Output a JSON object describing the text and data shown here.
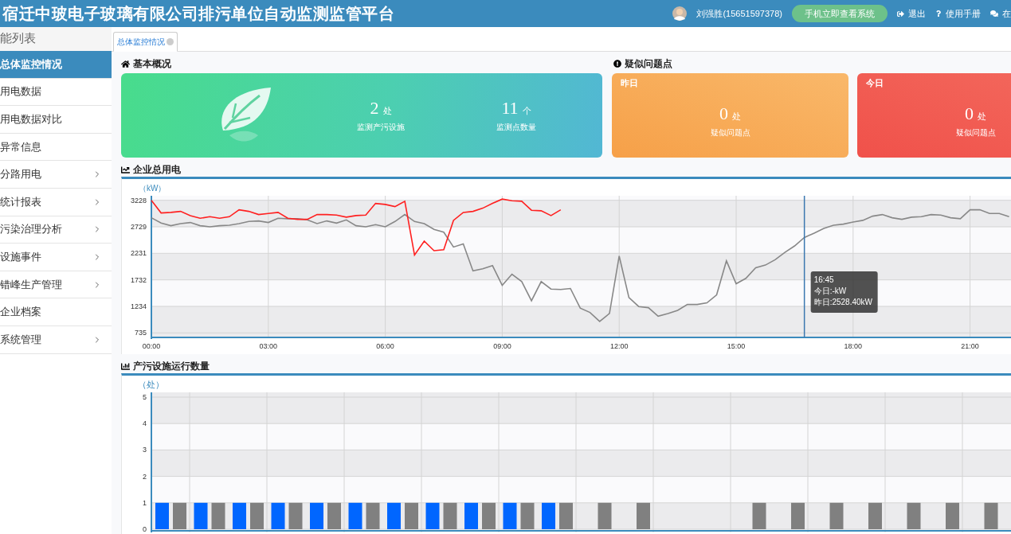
{
  "header": {
    "title": "宿迁中玻电子玻璃有限公司排污单位自动监测监管平台",
    "user": "刘强胜(15651597378)",
    "mobile_button": "手机立即查看系统",
    "links": [
      {
        "kind": "logout",
        "label": "退出"
      },
      {
        "kind": "help",
        "label": "使用手册"
      },
      {
        "kind": "chat",
        "label": "在"
      }
    ]
  },
  "sidebar": {
    "title": "能列表",
    "items": [
      {
        "label": "总体监控情况",
        "selected": true,
        "expandable": false
      },
      {
        "label": "用电数据",
        "selected": false,
        "expandable": false
      },
      {
        "label": "用电数据对比",
        "selected": false,
        "expandable": false
      },
      {
        "label": "异常信息",
        "selected": false,
        "expandable": false
      },
      {
        "label": "分路用电",
        "selected": false,
        "expandable": true
      },
      {
        "label": "统计报表",
        "selected": false,
        "expandable": true
      },
      {
        "label": "污染治理分析",
        "selected": false,
        "expandable": true
      },
      {
        "label": "设施事件",
        "selected": false,
        "expandable": true
      },
      {
        "label": "错峰生产管理",
        "selected": false,
        "expandable": true
      },
      {
        "label": "企业档案",
        "selected": false,
        "expandable": false
      },
      {
        "label": "系统管理",
        "selected": false,
        "expandable": true
      }
    ]
  },
  "tabs": [
    {
      "label": "总体监控情况",
      "selected": true
    }
  ],
  "overview": {
    "title": "基本概况",
    "stats": [
      {
        "value": "2",
        "unit": "处",
        "label": "监测产污设施"
      },
      {
        "value": "11",
        "unit": "个",
        "label": "监测点数量"
      }
    ]
  },
  "issues": {
    "title": "疑似问题点",
    "cards": [
      {
        "kind": "yesterday",
        "title": "昨日",
        "value": "0",
        "unit": "处",
        "label": "疑似问题点"
      },
      {
        "kind": "today",
        "title": "今日",
        "value": "0",
        "unit": "处",
        "label": "疑似问题点"
      }
    ]
  },
  "power_chart": {
    "title": "企业总用电",
    "unit": "（kW）",
    "chart_data": {
      "type": "line",
      "xlim": [
        0,
        22.05
      ],
      "ylim": [
        650,
        3313
      ],
      "xticks": [
        {
          "value": 0,
          "label": "00:00"
        },
        {
          "value": 3,
          "label": "03:00"
        },
        {
          "value": 6,
          "label": "06:00"
        },
        {
          "value": 9,
          "label": "09:00"
        },
        {
          "value": 12,
          "label": "12:00"
        },
        {
          "value": 15,
          "label": "15:00"
        },
        {
          "value": 18,
          "label": "18:00"
        },
        {
          "value": 21,
          "label": "21:00"
        }
      ],
      "yticks": [
        735,
        1234,
        1732,
        2231,
        2729,
        3228
      ],
      "series": [
        {
          "color": "#888888",
          "x": [
            0,
            0.25,
            0.5,
            0.75,
            1,
            1.25,
            1.5,
            1.75,
            2,
            2.25,
            2.5,
            2.75,
            3,
            3.25,
            3.5,
            3.75,
            4,
            4.25,
            4.5,
            4.75,
            5,
            5.25,
            5.5,
            5.75,
            6,
            6.25,
            6.5,
            6.75,
            7,
            7.25,
            7.5,
            7.75,
            8,
            8.25,
            8.5,
            8.75,
            9,
            9.25,
            9.5,
            9.75,
            10,
            10.25,
            10.5,
            10.75,
            11,
            11.25,
            11.5,
            11.75,
            12,
            12.25,
            12.5,
            12.75,
            13,
            13.25,
            13.5,
            13.75,
            14,
            14.25,
            14.5,
            14.75,
            15,
            15.25,
            15.5,
            15.75,
            16,
            16.25,
            16.5,
            16.75,
            17,
            17.25,
            17.5,
            17.75,
            18,
            18.25,
            18.5,
            18.75,
            19,
            19.25,
            19.5,
            19.75,
            20,
            20.25,
            20.5,
            20.75,
            21,
            21.25,
            21.5,
            21.75,
            22
          ],
          "values": [
            2900,
            2800,
            2750,
            2790,
            2810,
            2750,
            2730,
            2750,
            2760,
            2790,
            2830,
            2840,
            2810,
            2890,
            2880,
            2880,
            2860,
            2790,
            2840,
            2800,
            2860,
            2750,
            2730,
            2770,
            2730,
            2830,
            2960,
            2830,
            2790,
            2680,
            2630,
            2350,
            2410,
            1900,
            1940,
            2000,
            1630,
            1840,
            1700,
            1340,
            1700,
            1560,
            1550,
            1570,
            1200,
            1120,
            950,
            1100,
            2180,
            1400,
            1230,
            1210,
            1050,
            1100,
            1160,
            1270,
            1270,
            1300,
            1450,
            2090,
            1660,
            1760,
            1960,
            2010,
            2110,
            2250,
            2370,
            2528,
            2610,
            2700,
            2760,
            2780,
            2820,
            2850,
            2930,
            2960,
            2900,
            2870,
            2910,
            2920,
            2960,
            2950,
            2900,
            2880,
            3050,
            3050,
            2980,
            2980,
            2920
          ]
        },
        {
          "color": "#ff2020",
          "x": [
            0,
            0.25,
            0.5,
            0.75,
            1,
            1.25,
            1.5,
            1.75,
            2,
            2.25,
            2.5,
            2.75,
            3,
            3.25,
            3.5,
            3.75,
            4,
            4.25,
            4.5,
            4.75,
            5,
            5.25,
            5.5,
            5.75,
            6,
            6.25,
            6.5,
            6.75,
            7,
            7.25,
            7.5,
            7.75,
            8,
            8.25,
            8.5,
            8.75,
            9,
            9.25,
            9.5,
            9.75,
            10,
            10.25,
            10.5
          ],
          "values": [
            3228,
            2990,
            3000,
            3020,
            2940,
            2890,
            2920,
            2890,
            2920,
            3050,
            3020,
            2960,
            2980,
            3000,
            2890,
            2870,
            2870,
            2960,
            2960,
            2950,
            2910,
            2940,
            2950,
            3170,
            3150,
            3110,
            3210,
            2200,
            2460,
            2280,
            2300,
            2850,
            3000,
            3020,
            3080,
            3170,
            3250,
            3220,
            3210,
            3040,
            3030,
            2940,
            3050
          ]
        }
      ],
      "grid": true,
      "ref_lines": [
        {
          "axis": "x",
          "value": 16.75,
          "color": "#3b78b0"
        }
      ],
      "annotations": [
        "16:45\n今日:-kW\n昨日:2528.40kW"
      ]
    }
  },
  "facility_chart": {
    "title": "产污设施运行数量",
    "unit": "（处）",
    "chart_data": {
      "type": "bar",
      "grid": true,
      "ylim": [
        0,
        5
      ],
      "yticks": [
        0,
        1,
        2,
        3,
        4,
        5
      ],
      "series": [
        {
          "color": "#0066ff",
          "values": [
            1,
            1,
            1,
            1,
            1,
            1,
            1,
            1,
            1,
            1,
            1,
            null,
            null,
            null,
            null,
            null,
            null,
            null,
            null,
            null,
            null,
            null
          ]
        },
        {
          "color": "#808080",
          "values": [
            1,
            1,
            1,
            1,
            1,
            1,
            1,
            1,
            1,
            1,
            1,
            1,
            1,
            0,
            0,
            1,
            1,
            1,
            1,
            1,
            1,
            1
          ]
        }
      ]
    }
  }
}
